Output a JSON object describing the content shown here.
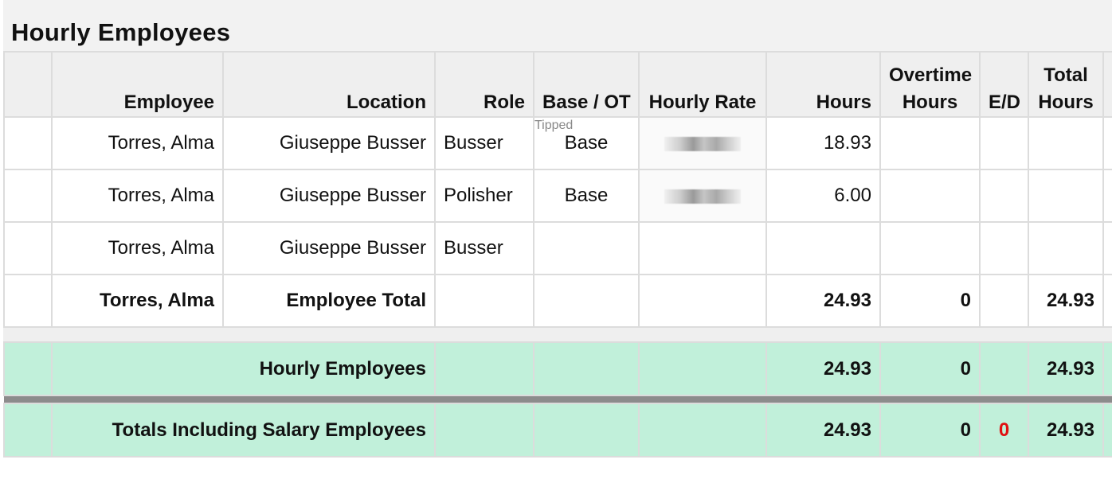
{
  "section": {
    "title": "Hourly Employees"
  },
  "columns": {
    "employee": "Employee",
    "location": "Location",
    "role": "Role",
    "base_ot": "Base / OT",
    "hourly_rate": "Hourly Rate",
    "hours": "Hours",
    "overtime_hours_1": "Overtime",
    "overtime_hours_2": "Hours",
    "ed": "E/D",
    "total_hours_1": "Total",
    "total_hours_2": "Hours"
  },
  "rows": [
    {
      "employee": "Torres, Alma",
      "location": "Giuseppe Busser",
      "role": "Busser",
      "tag": "Tipped",
      "base_ot": "Base",
      "hours": "18.93"
    },
    {
      "employee": "Torres, Alma",
      "location": "Giuseppe Busser",
      "role": "Polisher",
      "base_ot": "Base",
      "hours": "6.00"
    },
    {
      "employee": "Torres, Alma",
      "location": "Giuseppe Busser",
      "role": "Busser"
    }
  ],
  "employee_total": {
    "employee": "Torres, Alma",
    "label": "Employee Total",
    "hours": "24.93",
    "overtime": "0",
    "total": "24.93"
  },
  "hourly_total": {
    "label": "Hourly Employees",
    "hours": "24.93",
    "overtime": "0",
    "total": "24.93"
  },
  "grand_total": {
    "label": "Totals Including Salary Employees",
    "hours": "24.93",
    "overtime": "0",
    "ed": "0",
    "total": "24.93"
  },
  "colors": {
    "green_row": "#c1f0da",
    "ed_value": "#e01010",
    "divider": "#8c8c8c"
  }
}
